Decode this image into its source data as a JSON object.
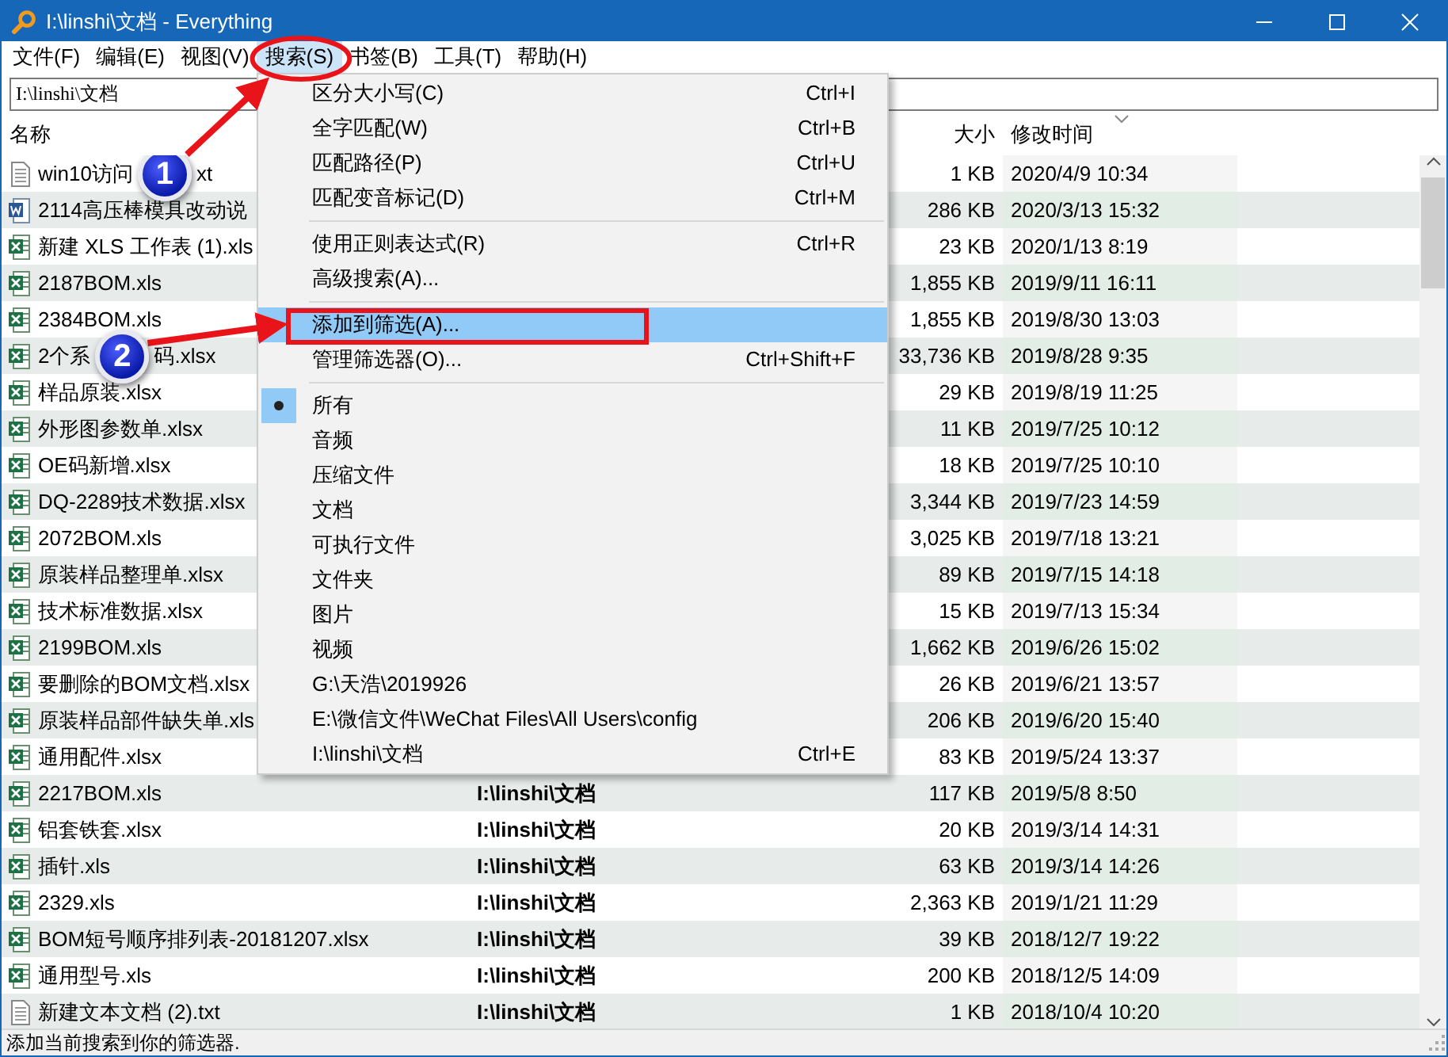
{
  "window": {
    "title": "I:\\linshi\\文档 - Everything"
  },
  "menu_bar": [
    {
      "label": "文件(F)",
      "selected": false
    },
    {
      "label": "编辑(E)",
      "selected": false
    },
    {
      "label": "视图(V)",
      "selected": false
    },
    {
      "label": "搜索(S)",
      "selected": true
    },
    {
      "label": "书签(B)",
      "selected": false
    },
    {
      "label": "工具(T)",
      "selected": false
    },
    {
      "label": "帮助(H)",
      "selected": false
    }
  ],
  "search": {
    "value": "I:\\linshi\\文档"
  },
  "columns": [
    {
      "kind": "name",
      "label": "名称"
    },
    {
      "kind": "path"
    },
    {
      "kind": "size",
      "label": "大小"
    },
    {
      "kind": "modified",
      "label": "修改时间",
      "sorted": true
    }
  ],
  "rows": [
    {
      "kind": "text",
      "name": "win10访问",
      "callout": "1",
      "name_after": "xt",
      "size": "1 KB",
      "modified": "2020/4/9 10:34"
    },
    {
      "kind": "word",
      "name": "2114高压棒模具改动说",
      "size": "286 KB",
      "modified": "2020/3/13 15:32"
    },
    {
      "kind": "excel",
      "name": "新建 XLS 工作表 (1).xls",
      "size": "23 KB",
      "modified": "2020/1/13 8:19"
    },
    {
      "kind": "excel",
      "name": "2187BOM.xls",
      "size": "1,855 KB",
      "modified": "2019/9/11 16:11"
    },
    {
      "kind": "excel",
      "name": "2384BOM.xls",
      "size": "1,855 KB",
      "modified": "2019/8/30 13:03"
    },
    {
      "kind": "excel",
      "name": "2个系",
      "callout": "2",
      "name_after": "码.xlsx",
      "size": "33,736 KB",
      "modified": "2019/8/28 9:35"
    },
    {
      "kind": "excel",
      "name": "样品原装.xlsx",
      "size": "29 KB",
      "modified": "2019/8/19 11:25"
    },
    {
      "kind": "excel",
      "name": "外形图参数单.xlsx",
      "size": "11 KB",
      "modified": "2019/7/25 10:12"
    },
    {
      "kind": "excel",
      "name": "OE码新增.xlsx",
      "size": "18 KB",
      "modified": "2019/7/25 10:10"
    },
    {
      "kind": "excel",
      "name": "DQ-2289技术数据.xlsx",
      "size": "3,344 KB",
      "modified": "2019/7/23 14:59"
    },
    {
      "kind": "excel",
      "name": "2072BOM.xls",
      "size": "3,025 KB",
      "modified": "2019/7/18 13:21"
    },
    {
      "kind": "excel",
      "name": "原装样品整理单.xlsx",
      "size": "89 KB",
      "modified": "2019/7/15 14:18"
    },
    {
      "kind": "excel",
      "name": "技术标准数据.xlsx",
      "size": "15 KB",
      "modified": "2019/7/13 15:34"
    },
    {
      "kind": "excel",
      "name": "2199BOM.xls",
      "size": "1,662 KB",
      "modified": "2019/6/26 15:02"
    },
    {
      "kind": "excel",
      "name": "要删除的BOM文档.xlsx",
      "size": "26 KB",
      "modified": "2019/6/21 13:57"
    },
    {
      "kind": "excel",
      "name": "原装样品部件缺失单.xls",
      "size": "206 KB",
      "modified": "2019/6/20 15:40"
    },
    {
      "kind": "excel",
      "name": "通用配件.xlsx",
      "size": "83 KB",
      "modified": "2019/5/24 13:37"
    },
    {
      "kind": "excel",
      "name": "2217BOM.xls",
      "path": "I:\\linshi\\文档",
      "size": "117 KB",
      "modified": "2019/5/8 8:50"
    },
    {
      "kind": "excel",
      "name": "铝套铁套.xlsx",
      "path": "I:\\linshi\\文档",
      "size": "20 KB",
      "modified": "2019/3/14 14:31"
    },
    {
      "kind": "excel",
      "name": "插针.xls",
      "path": "I:\\linshi\\文档",
      "size": "63 KB",
      "modified": "2019/3/14 14:26"
    },
    {
      "kind": "excel",
      "name": "2329.xls",
      "path": "I:\\linshi\\文档",
      "size": "2,363 KB",
      "modified": "2019/1/21 11:29"
    },
    {
      "kind": "excel",
      "name": "BOM短号顺序排列表-20181207.xlsx",
      "path": "I:\\linshi\\文档",
      "size": "39 KB",
      "modified": "2018/12/7 19:22"
    },
    {
      "kind": "excel",
      "name": "通用型号.xls",
      "path": "I:\\linshi\\文档",
      "size": "200 KB",
      "modified": "2018/12/5 14:09"
    },
    {
      "kind": "text",
      "name": "新建文本文档 (2).txt",
      "path": "I:\\linshi\\文档",
      "size": "1 KB",
      "modified": "2018/10/4 10:20"
    }
  ],
  "menu": [
    {
      "kind": "item",
      "label": "区分大小写(C)",
      "shortcut": "Ctrl+I",
      "selected": false
    },
    {
      "kind": "item",
      "label": "全字匹配(W)",
      "shortcut": "Ctrl+B",
      "selected": false
    },
    {
      "kind": "item",
      "label": "匹配路径(P)",
      "shortcut": "Ctrl+U",
      "selected": false
    },
    {
      "kind": "item",
      "label": "匹配变音标记(D)",
      "shortcut": "Ctrl+M",
      "selected": false
    },
    {
      "kind": "separator"
    },
    {
      "kind": "item",
      "label": "使用正则表达式(R)",
      "shortcut": "Ctrl+R",
      "selected": false
    },
    {
      "kind": "item",
      "label": "高级搜索(A)...",
      "selected": false
    },
    {
      "kind": "separator"
    },
    {
      "kind": "item",
      "label": "添加到筛选(A)...",
      "selected": true
    },
    {
      "kind": "item",
      "label": "管理筛选器(O)...",
      "shortcut": "Ctrl+Shift+F",
      "selected": false
    },
    {
      "kind": "separator"
    },
    {
      "kind": "radio",
      "label": "所有",
      "checked": true,
      "selected": false
    },
    {
      "kind": "radio",
      "label": "音频",
      "checked": false,
      "selected": false
    },
    {
      "kind": "radio",
      "label": "压缩文件",
      "checked": false,
      "selected": false
    },
    {
      "kind": "radio",
      "label": "文档",
      "checked": false,
      "selected": false
    },
    {
      "kind": "radio",
      "label": "可执行文件",
      "checked": false,
      "selected": false
    },
    {
      "kind": "radio",
      "label": "文件夹",
      "checked": false,
      "selected": false
    },
    {
      "kind": "radio",
      "label": "图片",
      "checked": false,
      "selected": false
    },
    {
      "kind": "radio",
      "label": "视频",
      "checked": false,
      "selected": false
    },
    {
      "kind": "radio",
      "label": "G:\\天浩\\2019926",
      "checked": false,
      "selected": false
    },
    {
      "kind": "radio",
      "label": "E:\\微信文件\\WeChat Files\\All Users\\config",
      "checked": false,
      "selected": false
    },
    {
      "kind": "radio",
      "label": "I:\\linshi\\文档",
      "shortcut": "Ctrl+E",
      "checked": false,
      "selected": false
    }
  ],
  "status_bar": {
    "text": "添加当前搜索到你的筛选器."
  }
}
